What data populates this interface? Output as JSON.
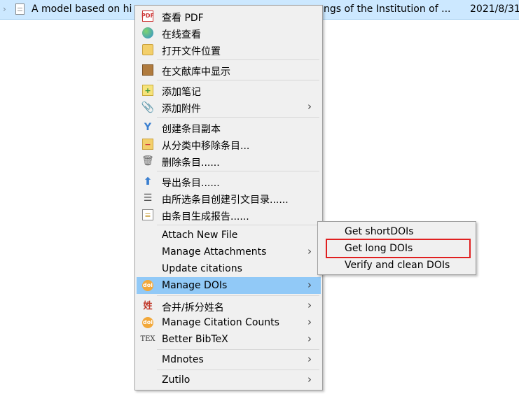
{
  "row": {
    "title_left": "A model based on hi",
    "title_right": "ngs of the Institution of ...",
    "date": "2021/8/31",
    "twisty": "›"
  },
  "menu": {
    "items": [
      {
        "label": "查看 PDF",
        "icon": "pdf-icon",
        "glyph": "PDF"
      },
      {
        "label": "在线查看",
        "icon": "globe-icon",
        "glyph": ""
      },
      {
        "label": "打开文件位置",
        "icon": "folder-icon",
        "glyph": ""
      },
      {
        "label": "在文献库中显示",
        "icon": "library-box-icon",
        "glyph": ""
      },
      {
        "label": "添加笔记",
        "icon": "add-note-icon",
        "glyph": "+"
      },
      {
        "label": "添加附件",
        "icon": "paperclip-icon",
        "glyph": "📎",
        "submenu": true
      },
      {
        "label": "创建条目副本",
        "icon": "duplicate-icon",
        "glyph": "Y"
      },
      {
        "label": "从分类中移除条目...",
        "icon": "remove-from-collection-icon",
        "glyph": "−"
      },
      {
        "label": "删除条目......",
        "icon": "trash-icon",
        "glyph": "🗑"
      },
      {
        "label": "导出条目......",
        "icon": "export-icon",
        "glyph": "⬆"
      },
      {
        "label": "由所选条目创建引文目录......",
        "icon": "bibliography-icon",
        "glyph": "☰"
      },
      {
        "label": "由条目生成报告......",
        "icon": "report-icon",
        "glyph": "≡"
      },
      {
        "label": "Attach New File",
        "icon": "",
        "glyph": ""
      },
      {
        "label": "Manage Attachments",
        "icon": "",
        "glyph": "",
        "submenu": true
      },
      {
        "label": "Update citations",
        "icon": "",
        "glyph": ""
      },
      {
        "label": "Manage DOIs",
        "icon": "doi-icon",
        "glyph": "doi",
        "submenu": true,
        "highlighted": true
      },
      {
        "label": "合并/拆分姓名",
        "icon": "name-split-icon",
        "glyph": "姓",
        "submenu": true
      },
      {
        "label": "Manage Citation Counts",
        "icon": "doi-icon",
        "glyph": "doi",
        "submenu": true
      },
      {
        "label": "Better BibTeX",
        "icon": "tex-icon",
        "glyph": "TEX",
        "submenu": true
      },
      {
        "label": "Mdnotes",
        "icon": "",
        "glyph": "",
        "submenu": true
      },
      {
        "label": "Zutilo",
        "icon": "",
        "glyph": "",
        "submenu": true
      }
    ],
    "arrow": "›"
  },
  "submenu": {
    "items": [
      {
        "label": "Get shortDOIs"
      },
      {
        "label": "Get long DOIs",
        "annotated": true
      },
      {
        "label": "Verify and clean DOIs"
      }
    ]
  },
  "colors": {
    "row_selected": "#cce8ff",
    "menu_bg": "#f0f0f0",
    "menu_highlight": "#91c9f7",
    "annotation_red": "#e02020"
  }
}
